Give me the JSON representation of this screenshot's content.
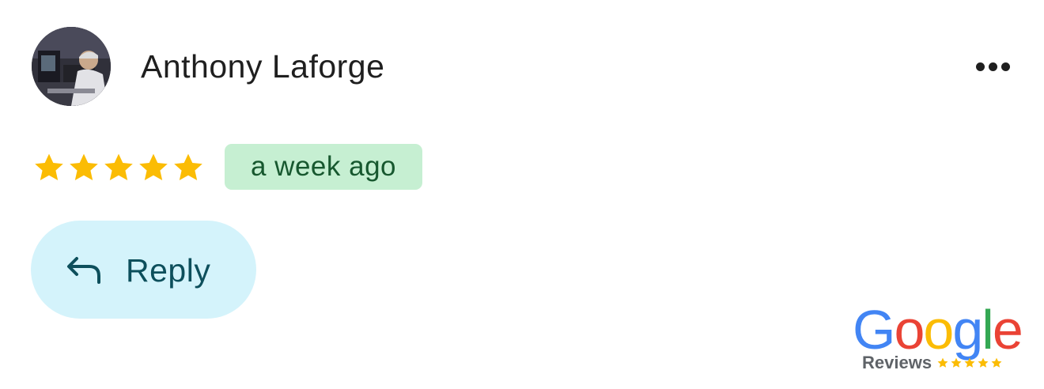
{
  "review": {
    "reviewer_name": "Anthony Laforge",
    "rating": 5,
    "rating_max": 5,
    "time_ago": "a week ago",
    "reply_label": "Reply"
  },
  "branding": {
    "google_letters": [
      "G",
      "o",
      "o",
      "g",
      "l",
      "e"
    ],
    "reviews_label": "Reviews",
    "mini_stars": 5
  },
  "icons": {
    "avatar": "avatar-photo",
    "more": "more-horizontal-icon",
    "star": "star-icon",
    "reply": "reply-arrow-icon"
  },
  "colors": {
    "star": "#fbbc04",
    "badge_bg": "#c6efd2",
    "badge_text": "#17582f",
    "reply_bg": "#d4f3fb",
    "reply_text": "#0d4f5c",
    "google_blue": "#4285f4",
    "google_red": "#ea4335",
    "google_yellow": "#fbbc05",
    "google_green": "#34a853"
  }
}
